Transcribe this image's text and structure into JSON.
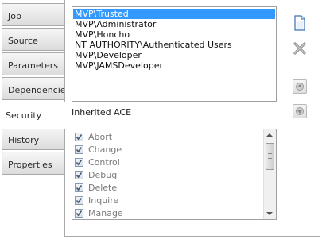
{
  "tabs": [
    {
      "label": "Job",
      "active": false
    },
    {
      "label": "Source",
      "active": false
    },
    {
      "label": "Parameters",
      "active": false
    },
    {
      "label": "Dependencies",
      "active": false
    },
    {
      "label": "Security",
      "active": true
    },
    {
      "label": "History",
      "active": false
    },
    {
      "label": "Properties",
      "active": false
    }
  ],
  "security": {
    "ace_list": [
      {
        "name": "MVP\\Trusted",
        "selected": true
      },
      {
        "name": "MVP\\Administrator",
        "selected": false
      },
      {
        "name": "MVP\\Honcho",
        "selected": false
      },
      {
        "name": "NT AUTHORITY\\Authenticated Users",
        "selected": false
      },
      {
        "name": "MVP\\Developer",
        "selected": false
      },
      {
        "name": "MVP\\JAMSDeveloper",
        "selected": false
      }
    ],
    "buttons": {
      "add_icon": "new-document-icon",
      "delete_icon": "delete-x-icon",
      "move_up_icon": "move-up-icon",
      "move_down_icon": "move-down-icon"
    },
    "inherited_label": "Inherited ACE",
    "permissions": [
      {
        "label": "Abort",
        "checked": true
      },
      {
        "label": "Change",
        "checked": true
      },
      {
        "label": "Control",
        "checked": true
      },
      {
        "label": "Debug",
        "checked": true
      },
      {
        "label": "Delete",
        "checked": true
      },
      {
        "label": "Inquire",
        "checked": true
      },
      {
        "label": "Manage",
        "checked": true
      }
    ]
  },
  "colors": {
    "selection": "#3399ff",
    "disabled_text": "#7a7a7a"
  }
}
